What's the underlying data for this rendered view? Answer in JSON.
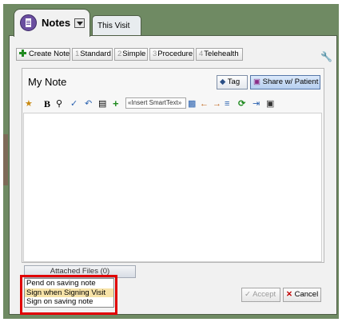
{
  "tabs": {
    "notes_label": "Notes",
    "visit_label": "This Visit",
    "notes_icon": "notes-icon",
    "dropdown_icon": "chevron-down-icon"
  },
  "toolbar": {
    "create_note": "Create Note",
    "templates": [
      {
        "num": "1",
        "label": "Standard"
      },
      {
        "num": "2",
        "label": "Simple"
      },
      {
        "num": "3",
        "label": "Procedure"
      },
      {
        "num": "4",
        "label": "Telehealth"
      }
    ],
    "settings_icon": "wrench-icon"
  },
  "editor": {
    "title": "My Note",
    "tag_label": "Tag",
    "share_label": "Share w/ Patient",
    "smarttext_placeholder": "«Insert SmartText»",
    "format_icons": [
      "star-icon",
      "bold-icon",
      "find-icon",
      "spellcheck-icon",
      "undo-icon",
      "paste-icon",
      "add-icon",
      "smarttext-icon",
      "arrow-left-icon",
      "arrow-right-icon",
      "list-icon",
      "refresh-icon",
      "import-icon",
      "contact-icon"
    ],
    "body": ""
  },
  "attached_files": "Attached Files (0)",
  "save_options": [
    {
      "label": "Pend on saving note",
      "selected": false
    },
    {
      "label": "Sign when Signing Visit",
      "selected": true
    },
    {
      "label": "Sign on saving note",
      "selected": false
    }
  ],
  "actions": {
    "accept_label": "Accept",
    "cancel_label": "Cancel"
  },
  "colors": {
    "window_frame": "#6f8a63",
    "notes_icon": "#6b4fa0",
    "highlight": "#e00000",
    "selected_option": "#f7e3a8"
  }
}
